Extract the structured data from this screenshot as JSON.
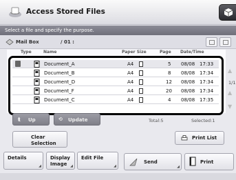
{
  "header": {
    "title": "Access Stored Files",
    "corner_button_icon": "cube-icon"
  },
  "instruction": "Select a file and specify the purpose.",
  "location": {
    "label": "Mail Box",
    "box_number": "/ 01 :"
  },
  "columns": [
    "Type",
    "Name",
    "Paper Size",
    "Page",
    "Date/Time"
  ],
  "files": [
    {
      "name": "Document_A",
      "size": "A4",
      "pages": "5",
      "date": "08/08",
      "time": "17:33",
      "selected": true
    },
    {
      "name": "Document_B",
      "size": "A4",
      "pages": "8",
      "date": "08/08",
      "time": "17:34",
      "selected": false
    },
    {
      "name": "Document_D",
      "size": "A4",
      "pages": "12",
      "date": "08/08",
      "time": "17:34",
      "selected": false
    },
    {
      "name": "Document_F",
      "size": "A4",
      "pages": "20",
      "date": "08/08",
      "time": "17:34",
      "selected": false
    },
    {
      "name": "Document_C",
      "size": "A4",
      "pages": "4",
      "date": "08/08",
      "time": "17:35",
      "selected": false
    }
  ],
  "pager": {
    "page_indicator": "1/1"
  },
  "actions": {
    "up": "Up",
    "update": "Update",
    "total": "Total:5",
    "selected": "Selected:1",
    "clear_selection_line1": "Clear",
    "clear_selection_line2": "Selection",
    "print_list": "Print List",
    "details": "Details",
    "display_image_line1": "Display",
    "display_image_line2": "Image",
    "edit_file": "Edit File",
    "send": "Send",
    "print": "Print"
  }
}
